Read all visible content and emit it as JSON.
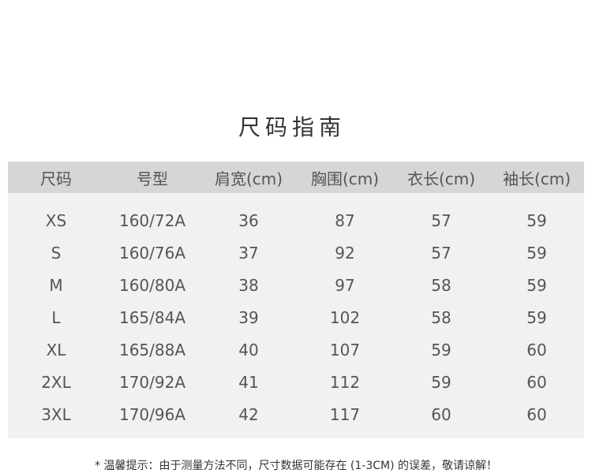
{
  "title": "尺码指南",
  "table": {
    "headers": [
      "尺码",
      "号型",
      "肩宽(cm)",
      "胸围(cm)",
      "衣长(cm)",
      "袖长(cm)"
    ],
    "rows": [
      [
        "XS",
        "160/72A",
        "36",
        "87",
        "57",
        "59"
      ],
      [
        "S",
        "160/76A",
        "37",
        "92",
        "57",
        "59"
      ],
      [
        "M",
        "160/80A",
        "38",
        "97",
        "58",
        "59"
      ],
      [
        "L",
        "165/84A",
        "39",
        "102",
        "58",
        "59"
      ],
      [
        "XL",
        "165/88A",
        "40",
        "107",
        "59",
        "60"
      ],
      [
        "2XL",
        "170/92A",
        "41",
        "112",
        "59",
        "60"
      ],
      [
        "3XL",
        "170/96A",
        "42",
        "117",
        "60",
        "60"
      ]
    ]
  },
  "note": "* 温馨提示：由于测量方法不同，尺寸数据可能存在 (1-3CM) 的误差，敬请谅解！"
}
